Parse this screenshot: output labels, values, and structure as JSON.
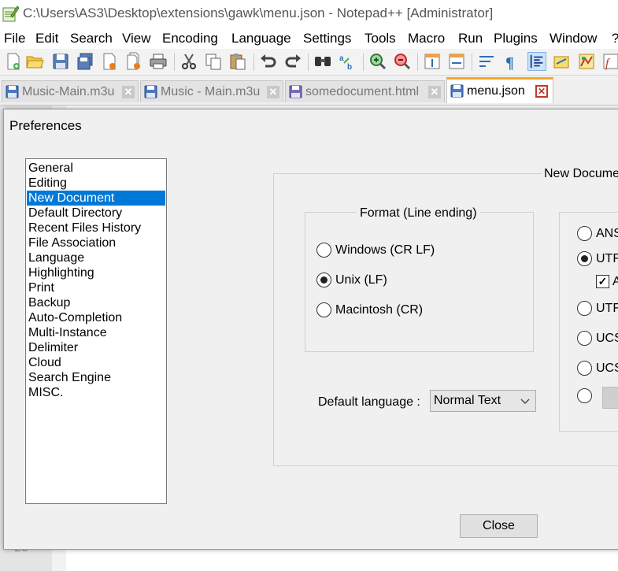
{
  "window": {
    "title": "C:\\Users\\AS3\\Desktop\\extensions\\gawk\\menu.json - Notepad++ [Administrator]"
  },
  "menu": [
    "File",
    "Edit",
    "Search",
    "View",
    "Encoding",
    "Language",
    "Settings",
    "Tools",
    "Macro",
    "Run",
    "Plugins",
    "Window",
    "?"
  ],
  "toolbar": {
    "icons": [
      "new-file-icon",
      "open-file-icon",
      "save-icon",
      "save-all-icon",
      "close-icon",
      "close-all-icon",
      "print-icon",
      "cut-icon",
      "copy-icon",
      "paste-icon",
      "undo-icon",
      "redo-icon",
      "find-icon",
      "replace-icon",
      "zoom-in-icon",
      "zoom-out-icon",
      "sync-vertical-icon",
      "sync-horizontal-icon",
      "word-wrap-icon",
      "show-all-characters-icon",
      "indent-guide-icon",
      "user-language-icon",
      "document-map-icon",
      "function-list-icon"
    ]
  },
  "tabs": [
    {
      "label": "Music-Main.m3u",
      "active": false
    },
    {
      "label": "Music - Main.m3u",
      "active": false
    },
    {
      "label": "somedocument.html",
      "active": false
    },
    {
      "label": "menu.json",
      "active": true
    }
  ],
  "gutter": {
    "line_number": "23"
  },
  "dialog": {
    "title": "Preferences",
    "categories": [
      "General",
      "Editing",
      "New Document",
      "Default Directory",
      "Recent Files History",
      "File Association",
      "Language",
      "Highlighting",
      "Print",
      "Backup",
      "Auto-Completion",
      "Multi-Instance",
      "Delimiter",
      "Cloud",
      "Search Engine",
      "MISC."
    ],
    "selected_category": "New Document",
    "new_document_group_title": "New Docume",
    "format_group": {
      "title": "Format (Line ending)",
      "options": [
        {
          "label": "Windows (CR LF)",
          "checked": false
        },
        {
          "label": "Unix (LF)",
          "checked": true
        },
        {
          "label": "Macintosh (CR)",
          "checked": false
        }
      ]
    },
    "encoding_group": {
      "options": [
        {
          "label": "ANS",
          "checked": false
        },
        {
          "label": "UTF",
          "checked": true
        },
        {
          "label": "UTF",
          "checked": false
        },
        {
          "label": "UCS",
          "checked": false
        },
        {
          "label": "UCS",
          "checked": false
        },
        {
          "label": "",
          "checked": false
        }
      ],
      "checkbox": {
        "label": "A",
        "checked": true
      }
    },
    "default_language": {
      "label": "Default language :",
      "value": "Normal Text"
    },
    "close_button": "Close"
  },
  "colors": {
    "selection": "#0078d7",
    "active_tab_accent": "#f5a623",
    "tab_close_active": "#c0392b"
  }
}
